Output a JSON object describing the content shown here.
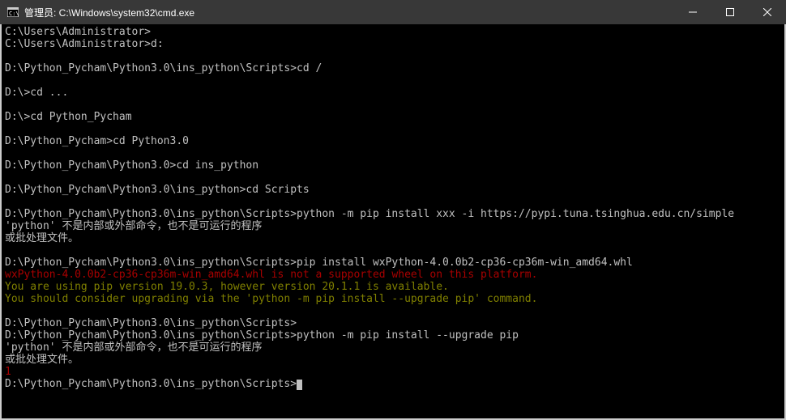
{
  "window": {
    "title": "管理员: C:\\Windows\\system32\\cmd.exe"
  },
  "terminal": {
    "lines": [
      {
        "color": "white",
        "text": "C:\\Users\\Administrator>"
      },
      {
        "color": "white",
        "text": "C:\\Users\\Administrator>d:"
      },
      {
        "color": "white",
        "text": ""
      },
      {
        "color": "white",
        "text": "D:\\Python_Pycham\\Python3.0\\ins_python\\Scripts>cd /"
      },
      {
        "color": "white",
        "text": ""
      },
      {
        "color": "white",
        "text": "D:\\>cd ..."
      },
      {
        "color": "white",
        "text": ""
      },
      {
        "color": "white",
        "text": "D:\\>cd Python_Pycham"
      },
      {
        "color": "white",
        "text": ""
      },
      {
        "color": "white",
        "text": "D:\\Python_Pycham>cd Python3.0"
      },
      {
        "color": "white",
        "text": ""
      },
      {
        "color": "white",
        "text": "D:\\Python_Pycham\\Python3.0>cd ins_python"
      },
      {
        "color": "white",
        "text": ""
      },
      {
        "color": "white",
        "text": "D:\\Python_Pycham\\Python3.0\\ins_python>cd Scripts"
      },
      {
        "color": "white",
        "text": ""
      },
      {
        "color": "white",
        "text": "D:\\Python_Pycham\\Python3.0\\ins_python\\Scripts>python -m pip install xxx -i https://pypi.tuna.tsinghua.edu.cn/simple"
      },
      {
        "color": "white",
        "text": "'python' 不是内部或外部命令，也不是可运行的程序"
      },
      {
        "color": "white",
        "text": "或批处理文件。"
      },
      {
        "color": "white",
        "text": ""
      },
      {
        "color": "white",
        "text": "D:\\Python_Pycham\\Python3.0\\ins_python\\Scripts>pip install wxPython-4.0.0b2-cp36-cp36m-win_amd64.whl"
      },
      {
        "color": "red",
        "text": "wxPython-4.0.0b2-cp36-cp36m-win_amd64.whl is not a supported wheel on this platform."
      },
      {
        "color": "yellow",
        "text": "You are using pip version 19.0.3, however version 20.1.1 is available."
      },
      {
        "color": "yellow",
        "text": "You should consider upgrading via the 'python -m pip install --upgrade pip' command."
      },
      {
        "color": "white",
        "text": ""
      },
      {
        "color": "white",
        "text": "D:\\Python_Pycham\\Python3.0\\ins_python\\Scripts>"
      },
      {
        "color": "white",
        "text": "D:\\Python_Pycham\\Python3.0\\ins_python\\Scripts>python -m pip install --upgrade pip"
      },
      {
        "color": "white",
        "text": "'python' 不是内部或外部命令，也不是可运行的程序"
      },
      {
        "color": "white",
        "text": "或批处理文件。"
      },
      {
        "color": "red",
        "text": "1"
      },
      {
        "color": "white",
        "text": "D:\\Python_Pycham\\Python3.0\\ins_python\\Scripts>"
      }
    ]
  }
}
